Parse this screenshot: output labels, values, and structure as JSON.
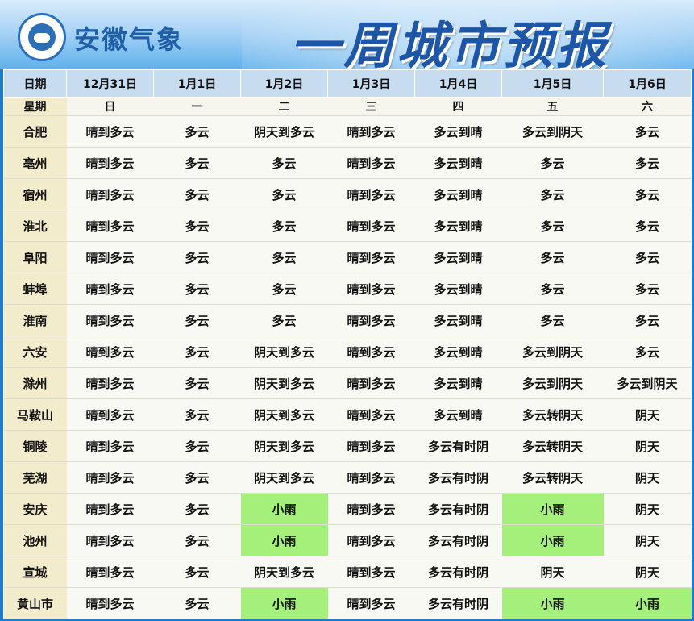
{
  "header": {
    "brand": "安徽气象",
    "title": "一周城市预报"
  },
  "colors": {
    "header_blue": "#1d56a6",
    "rain_highlight": "#a5f07a",
    "city_column": "#f2eccc"
  },
  "table": {
    "date_label": "日期",
    "weekday_label": "星期",
    "dates": [
      "12月31日",
      "1月1日",
      "1月2日",
      "1月3日",
      "1月4日",
      "1月5日",
      "1月6日"
    ],
    "weekdays": [
      "日",
      "一",
      "二",
      "三",
      "四",
      "五",
      "六"
    ],
    "rows": [
      {
        "city": "合肥",
        "f": [
          "晴到多云",
          "多云",
          "阴天到多云",
          "晴到多云",
          "多云到晴",
          "多云到阴天",
          "多云"
        ]
      },
      {
        "city": "亳州",
        "f": [
          "晴到多云",
          "多云",
          "多云",
          "晴到多云",
          "多云到晴",
          "多云",
          "多云"
        ]
      },
      {
        "city": "宿州",
        "f": [
          "晴到多云",
          "多云",
          "多云",
          "晴到多云",
          "多云到晴",
          "多云",
          "多云"
        ]
      },
      {
        "city": "淮北",
        "f": [
          "晴到多云",
          "多云",
          "多云",
          "晴到多云",
          "多云到晴",
          "多云",
          "多云"
        ]
      },
      {
        "city": "阜阳",
        "f": [
          "晴到多云",
          "多云",
          "多云",
          "晴到多云",
          "多云到晴",
          "多云",
          "多云"
        ]
      },
      {
        "city": "蚌埠",
        "f": [
          "晴到多云",
          "多云",
          "多云",
          "晴到多云",
          "多云到晴",
          "多云",
          "多云"
        ]
      },
      {
        "city": "淮南",
        "f": [
          "晴到多云",
          "多云",
          "多云",
          "晴到多云",
          "多云到晴",
          "多云",
          "多云"
        ]
      },
      {
        "city": "六安",
        "f": [
          "晴到多云",
          "多云",
          "阴天到多云",
          "晴到多云",
          "多云到晴",
          "多云到阴天",
          "多云"
        ]
      },
      {
        "city": "滁州",
        "f": [
          "晴到多云",
          "多云",
          "阴天到多云",
          "晴到多云",
          "多云到晴",
          "多云到阴天",
          "多云到阴天"
        ]
      },
      {
        "city": "马鞍山",
        "f": [
          "晴到多云",
          "多云",
          "阴天到多云",
          "晴到多云",
          "多云到晴",
          "多云转阴天",
          "阴天"
        ]
      },
      {
        "city": "铜陵",
        "f": [
          "晴到多云",
          "多云",
          "阴天到多云",
          "晴到多云",
          "多云有时阴",
          "多云转阴天",
          "阴天"
        ]
      },
      {
        "city": "芜湖",
        "f": [
          "晴到多云",
          "多云",
          "阴天到多云",
          "晴到多云",
          "多云有时阴",
          "多云转阴天",
          "阴天"
        ]
      },
      {
        "city": "安庆",
        "f": [
          "晴到多云",
          "多云",
          "小雨",
          "晴到多云",
          "多云有时阴",
          "小雨",
          "阴天"
        ]
      },
      {
        "city": "池州",
        "f": [
          "晴到多云",
          "多云",
          "小雨",
          "晴到多云",
          "多云有时阴",
          "小雨",
          "阴天"
        ]
      },
      {
        "city": "宣城",
        "f": [
          "晴到多云",
          "多云",
          "阴天到多云",
          "晴到多云",
          "多云有时阴",
          "阴天",
          "阴天"
        ]
      },
      {
        "city": "黄山市",
        "f": [
          "晴到多云",
          "多云",
          "小雨",
          "晴到多云",
          "多云有时阴",
          "小雨",
          "小雨"
        ]
      }
    ]
  }
}
